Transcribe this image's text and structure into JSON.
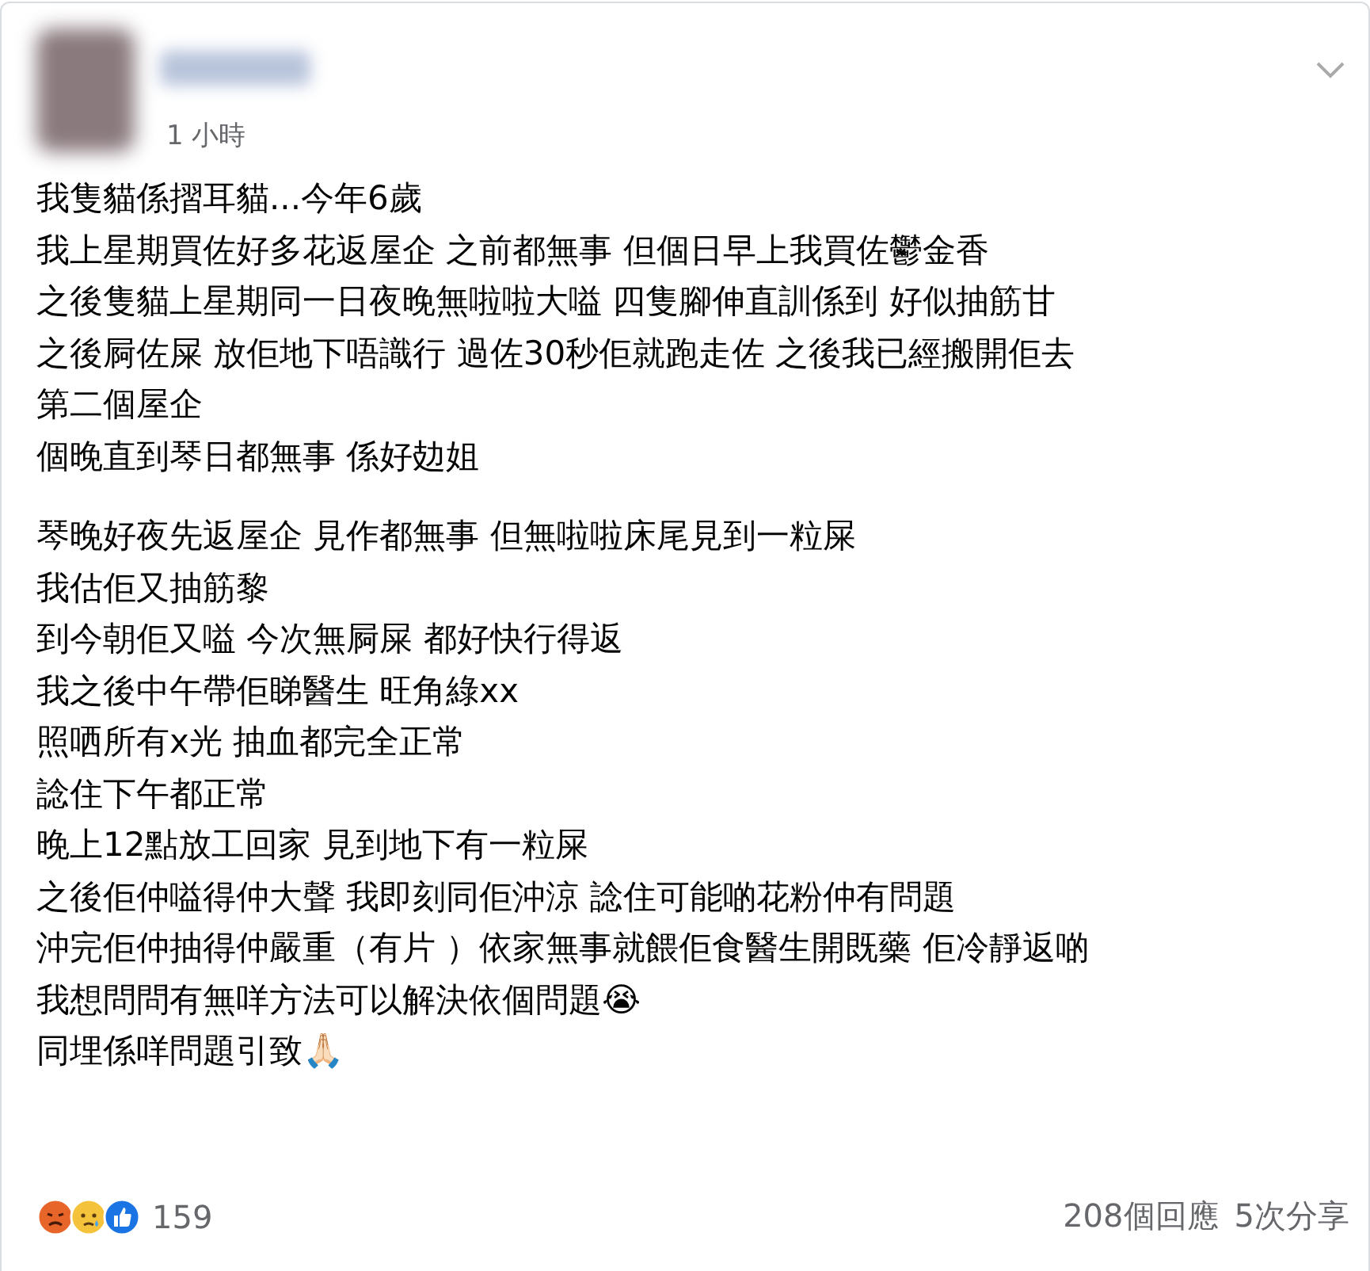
{
  "post": {
    "time": "1 小時",
    "paragraphs": [
      {
        "lines": [
          {
            "text": "我隻貓係摺耳貓...今年6歲"
          },
          {
            "text": "我上星期買佐好多花返屋企 之前都無事 但個日早上我買佐鬱金香"
          },
          {
            "text": "之後隻貓上星期同一日夜晚無啦啦大嗌 四隻腳伸直訓係到 好似抽筋甘"
          },
          {
            "text": "之後屙佐屎 放佢地下唔識行 過佐30秒佢就跑走佐 之後我已經搬開佢去"
          },
          {
            "text": "第二個屋企"
          },
          {
            "text": "個晚直到琴日都無事 係好攰姐"
          }
        ]
      },
      {
        "lines": [
          {
            "text": "琴晚好夜先返屋企 見作都無事 但無啦啦床尾見到一粒屎"
          },
          {
            "text": "我估佢又抽筋黎"
          },
          {
            "text": "到今朝佢又嗌 今次無屙屎 都好快行得返"
          },
          {
            "text": "我之後中午帶佢睇醫生 旺角綠xx"
          },
          {
            "text": "照哂所有x光 抽血都完全正常"
          },
          {
            "text": "諗住下午都正常"
          },
          {
            "text": "晚上12點放工回家 見到地下有一粒屎"
          },
          {
            "text": "之後佢仲嗌得仲大聲 我即刻同佢沖涼 諗住可能啲花粉仲有問題"
          },
          {
            "text": "沖完佢仲抽得仲嚴重（有片 ）依家無事就餵佢食醫生開既藥 佢冷靜返啲"
          },
          {
            "text": "我想問問有無咩方法可以解決依個問題😭"
          },
          {
            "text": "同埋係咩問題引致🙏🏻"
          }
        ]
      }
    ]
  },
  "footer": {
    "reactions": [
      {
        "kind": "angry"
      },
      {
        "kind": "sad"
      },
      {
        "kind": "like"
      }
    ],
    "reaction_count": "159",
    "comments": "208個回應",
    "shares": "5次分享"
  }
}
